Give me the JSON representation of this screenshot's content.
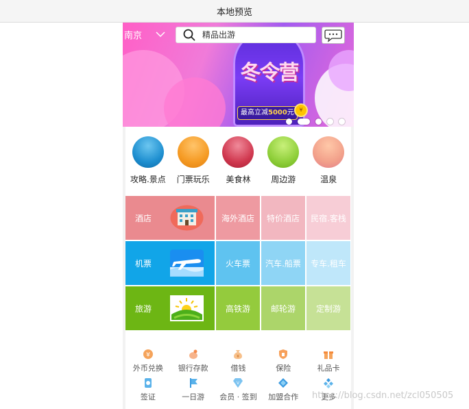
{
  "window": {
    "title": "本地预览"
  },
  "header": {
    "city": "南京",
    "search_placeholder": "精品出游"
  },
  "banner": {
    "title": "冬令营",
    "tag_prefix": "最高立减",
    "tag_amount": "5000",
    "tag_unit": "元",
    "slide_count": 5,
    "active_slide": 2
  },
  "categories": [
    {
      "label": "攻略.景点",
      "color": "#1e8fd0"
    },
    {
      "label": "门票玩乐",
      "color": "#f59a23"
    },
    {
      "label": "美食林",
      "color": "#d0384f"
    },
    {
      "label": "周边游",
      "color": "#8fcf3a"
    },
    {
      "label": "温泉",
      "color": "#f2a08a"
    }
  ],
  "grid": [
    {
      "main": "酒店",
      "icon": "hotel-icon",
      "color": "#ea8a8f",
      "items": [
        {
          "label": "海外酒店",
          "color": "#ee9aa1"
        },
        {
          "label": "特价酒店",
          "color": "#f2b7c0"
        },
        {
          "label": "民宿.客栈",
          "color": "#f7cdd6"
        }
      ]
    },
    {
      "main": "机票",
      "icon": "airplane-icon",
      "color": "#11a5e8",
      "items": [
        {
          "label": "火车票",
          "color": "#5fc3f0"
        },
        {
          "label": "汽车.船票",
          "color": "#8fd5f5"
        },
        {
          "label": "专车.租车",
          "color": "#bfe7fa"
        }
      ]
    },
    {
      "main": "旅游",
      "icon": "sunrise-icon",
      "color": "#6db614",
      "items": [
        {
          "label": "高铁游",
          "color": "#94cb3d"
        },
        {
          "label": "邮轮游",
          "color": "#acd56a"
        },
        {
          "label": "定制游",
          "color": "#c6e196"
        }
      ]
    }
  ],
  "services": [
    [
      {
        "label": "外币兑换",
        "icon": "currency-icon"
      },
      {
        "label": "银行存款",
        "icon": "piggy-bank-icon"
      },
      {
        "label": "借钱",
        "icon": "money-bag-icon"
      },
      {
        "label": "保险",
        "icon": "insurance-icon"
      },
      {
        "label": "礼品卡",
        "icon": "gift-icon"
      }
    ],
    [
      {
        "label": "签证",
        "icon": "visa-icon"
      },
      {
        "label": "一日游",
        "icon": "flag-icon"
      },
      {
        "label": "会员 · 签到",
        "icon": "vip-icon"
      },
      {
        "label": "加盟合作",
        "icon": "diamond-icon"
      },
      {
        "label": "更多",
        "icon": "more-icon"
      }
    ]
  ],
  "watermark": "https://blog.csdn.net/zcl050505"
}
